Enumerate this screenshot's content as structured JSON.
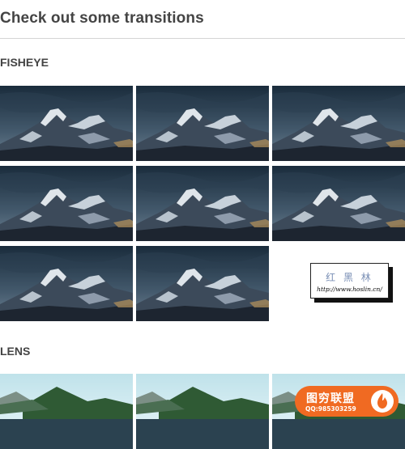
{
  "page": {
    "title": "Check out some transitions"
  },
  "sections": {
    "fisheye": {
      "heading": "FISHEYE",
      "image_count": 8,
      "image_subject": "snowy-mountain-photo"
    },
    "lens": {
      "heading": "LENS",
      "image_subject": "lake-forest-photo"
    }
  },
  "watermark": {
    "text": "红 黑 林",
    "url": "http://www.hoslin.cn/"
  },
  "badge": {
    "name": "图穷联盟",
    "qq": "QQ:985303259"
  },
  "colors": {
    "text": "#444444",
    "rule": "#d5d5d5",
    "badge": "#f06a22"
  }
}
